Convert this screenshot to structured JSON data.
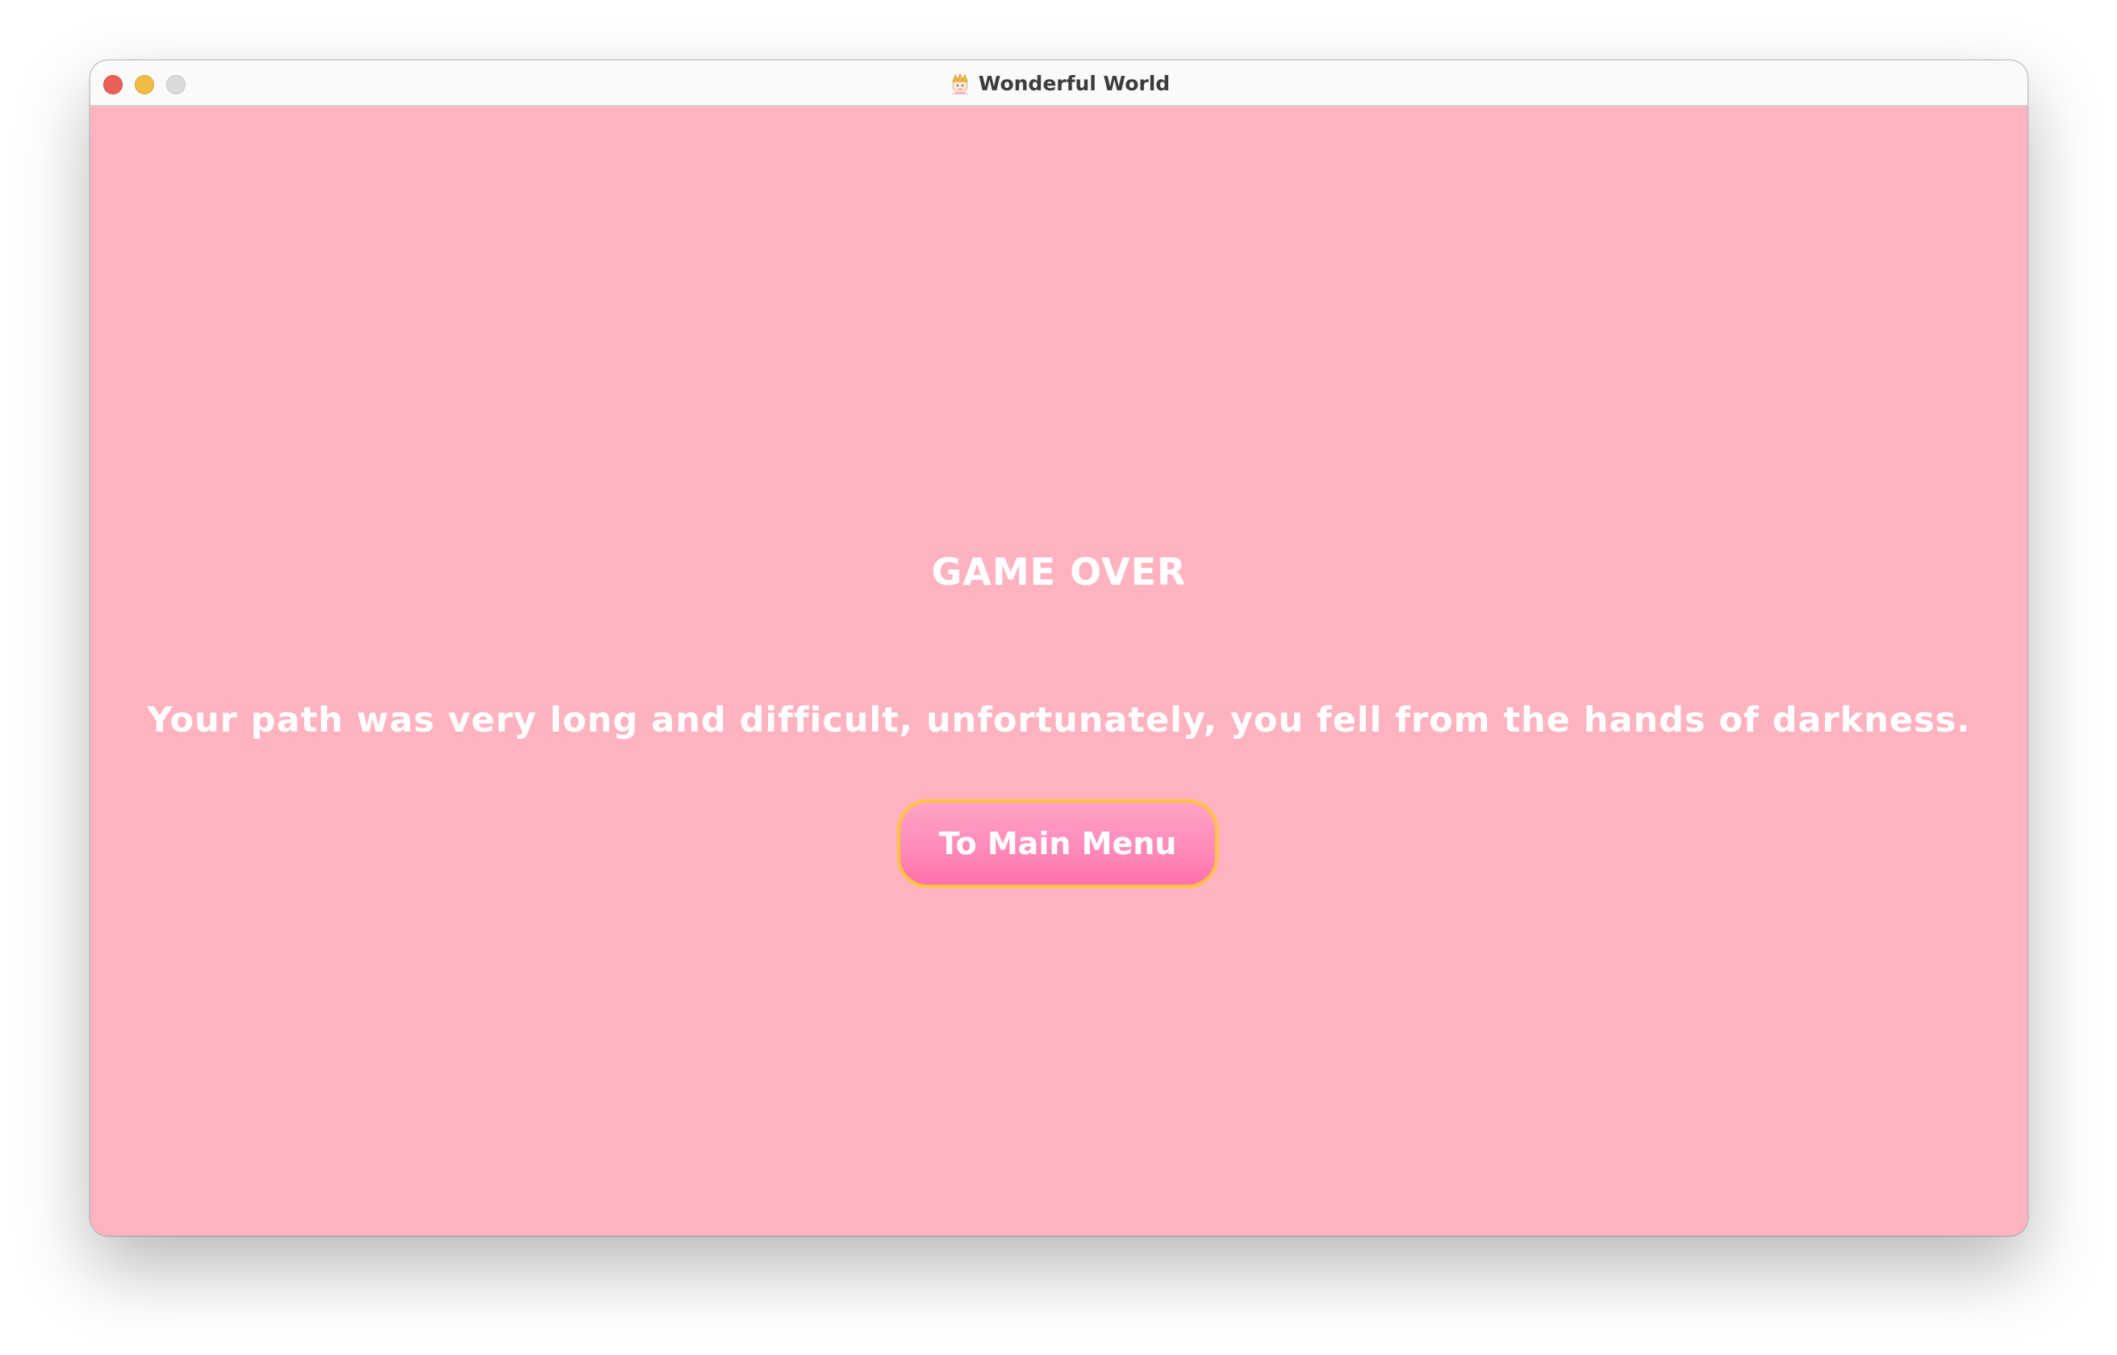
{
  "window": {
    "title": "Wonderful World",
    "app_icon": "princess-crown-icon"
  },
  "game_over": {
    "heading": "GAME OVER",
    "message": "Your path was very long and difficult, unfortunately, you fell from the hands of darkness.",
    "button_label": "To Main Menu"
  },
  "colors": {
    "background": "#ffb3c0",
    "button_fill": "#ff8bbb",
    "button_border": "#ffc43d",
    "text": "#ffffff"
  }
}
